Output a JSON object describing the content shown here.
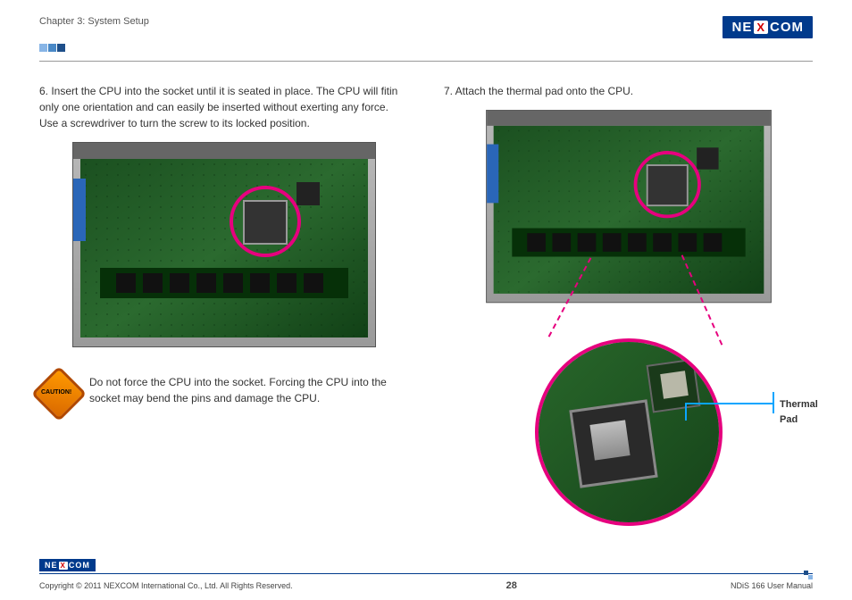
{
  "header": {
    "chapter": "Chapter 3: System Setup",
    "brand_left": "NE",
    "brand_x": "X",
    "brand_right": "COM"
  },
  "left": {
    "step_text": "6. Insert the CPU into the socket until it is seated in place. The CPU will fitin only one orientation and can easily be inserted without exerting any force. Use a screwdriver to turn the screw to its locked position.",
    "caution_label": "CAUTION!",
    "caution_text": "Do not force the CPU into the socket. Forcing the CPU into the socket may bend the pins and damage the CPU."
  },
  "right": {
    "step_text": "7. Attach the thermal pad onto the CPU.",
    "callout": "Thermal Pad"
  },
  "footer": {
    "copyright": "Copyright © 2011 NEXCOM International Co., Ltd. All Rights Reserved.",
    "page": "28",
    "doc": "NDiS 166 User Manual"
  }
}
